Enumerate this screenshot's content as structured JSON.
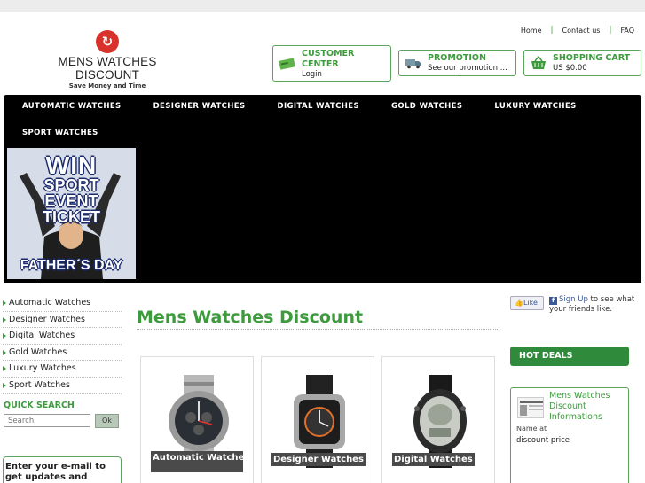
{
  "top_links": {
    "home": "Home",
    "contact": "Contact us",
    "faq": "FAQ",
    "separator": "|"
  },
  "logo": {
    "mark": "↻",
    "name": "MENS WATCHES DISCOUNT",
    "tagline": "Save Money and Time"
  },
  "header_boxes": {
    "customer_center": {
      "title": "CUSTOMER CENTER",
      "sub": "Login"
    },
    "promotion": {
      "title": "PROMOTION",
      "sub": "See our promotion ..."
    },
    "cart": {
      "title": "SHOPPING CART",
      "sub": "US $0.00"
    }
  },
  "nav": {
    "items": [
      "AUTOMATIC WATCHES",
      "DESIGNER WATCHES",
      "DIGITAL WATCHES",
      "GOLD WATCHES",
      "LUXURY WATCHES",
      "SPORT WATCHES"
    ]
  },
  "banner": {
    "l1": "WIN",
    "l2": "SPORT",
    "l3": "EVENT",
    "l4": "TICKET",
    "l5": "FATHER´S DAY"
  },
  "sidebar": {
    "categories": [
      "Automatic Watches",
      "Designer Watches",
      "Digital Watches",
      "Gold Watches",
      "Luxury Watches",
      "Sport Watches"
    ],
    "quick_search_title": "QUICK SEARCH",
    "search_placeholder": "Search",
    "search_button": "Ok",
    "email_promo": "Enter your e-mail to get updates and special"
  },
  "main": {
    "title": "Mens Watches Discount",
    "categories": [
      "Automatic Watches",
      "Designer Watches",
      "Digital Watches"
    ]
  },
  "social": {
    "like": "Like",
    "signup": "Sign Up",
    "rest": " to see what your friends like."
  },
  "hot_deals": {
    "title": "HOT DEALS",
    "item_title": "Mens Watches Discount Informations",
    "cut_text": "Name at",
    "item_text": "discount price"
  },
  "colors": {
    "accent_green": "#3d9b3d",
    "nav_black": "#000000",
    "deal_green": "#2f8a3c"
  },
  "icons": [
    "customer-center-icon",
    "truck-icon",
    "cart-icon",
    "facebook-icon",
    "thumbs-up-icon"
  ]
}
